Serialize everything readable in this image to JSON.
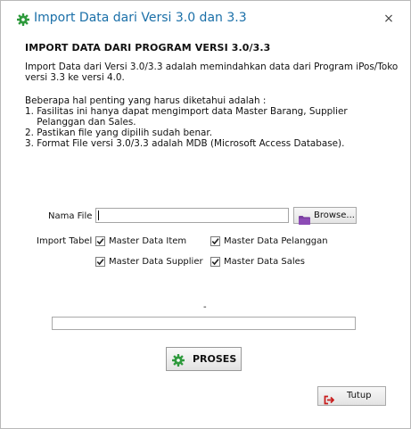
{
  "window": {
    "title": "Import Data dari Versi 3.0 dan 3.3",
    "close_glyph": "×",
    "icon": "gear-icon",
    "title_color": "#1a6fa8"
  },
  "content": {
    "heading": "IMPORT DATA DARI PROGRAM VERSI 3.0/3.3",
    "intro_lines": [
      "Import Data dari Versi 3.0/3.3 adalah memindahkan data dari Program iPos/Toko",
      "versi 3.3 ke versi 4.0."
    ],
    "notes_lines": [
      "Beberapa hal penting yang harus diketahui adalah :",
      "1. Fasilitas ini hanya dapat mengimport data Master Barang, Supplier",
      "    Pelanggan dan Sales.",
      "2. Pastikan file yang dipilih sudah benar.",
      "3. Format File versi 3.0/3.3 adalah MDB (Microsoft Access Database)."
    ]
  },
  "form": {
    "file_label": "Nama File :",
    "file_value": "",
    "browse_label": "Browse...",
    "browse_icon": "folder-icon",
    "import_table_label": "Import Tabel :",
    "options": [
      {
        "label": "Master Data Item",
        "checked": true
      },
      {
        "label": "Master Data Pelanggan",
        "checked": true
      },
      {
        "label": "Master Data Supplier",
        "checked": true
      },
      {
        "label": "Master Data Sales",
        "checked": true
      }
    ]
  },
  "status": {
    "text": "-",
    "progress": 0
  },
  "buttons": {
    "proses_label": "PROSES",
    "proses_icon": "gear-icon",
    "tutup_label": "Tutup",
    "tutup_icon": "exit-arrow-icon"
  },
  "colors": {
    "accent_green": "#2e9a3c",
    "folder_purple": "#7a3fa0",
    "exit_red": "#c81d1d"
  }
}
